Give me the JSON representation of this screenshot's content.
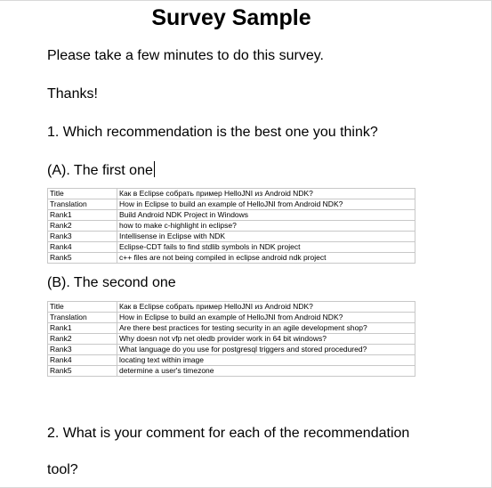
{
  "title": "Survey Sample",
  "intro": "Please take a few minutes to do this survey.",
  "thanks": "Thanks!",
  "question1": "1. Which recommendation is the best one you think?",
  "option_a": {
    "label": "(A). The first one",
    "rows": [
      {
        "key": "Title",
        "value": "Как в Eclipse собрать пример HelloJNI из Android NDK?"
      },
      {
        "key": "Translation",
        "value": "How in Eclipse to build an example of HelloJNI from Android NDK?"
      },
      {
        "key": "Rank1",
        "value": "Build Android NDK Project in Windows"
      },
      {
        "key": "Rank2",
        "value": "how to make c-highlight in eclipse?"
      },
      {
        "key": "Rank3",
        "value": "Intellisense in Eclipse with NDK"
      },
      {
        "key": "Rank4",
        "value": "Eclipse-CDT fails to find stdlib symbols in NDK project"
      },
      {
        "key": "Rank5",
        "value": "c++ files are not being compiled in eclipse android ndk project"
      }
    ]
  },
  "option_b": {
    "label": "(B). The second one",
    "rows": [
      {
        "key": "Title",
        "value": "Как в Eclipse собрать пример HelloJNI из Android NDK?"
      },
      {
        "key": "Translation",
        "value": "How in Eclipse to build an example of HelloJNI from Android NDK?"
      },
      {
        "key": "Rank1",
        "value": "Are there best practices for testing security in an agile development shop?"
      },
      {
        "key": "Rank2",
        "value": "Why doesn not vfp net oledb provider work in 64 bit windows?"
      },
      {
        "key": "Rank3",
        "value": "What language do you use for postgresql triggers and stored procedured?"
      },
      {
        "key": "Rank4",
        "value": "locating text within image"
      },
      {
        "key": "Rank5",
        "value": "determine a user's timezone"
      }
    ]
  },
  "question2_line1": "2. What is your comment for each of the recommendation",
  "question2_line2": "tool?"
}
